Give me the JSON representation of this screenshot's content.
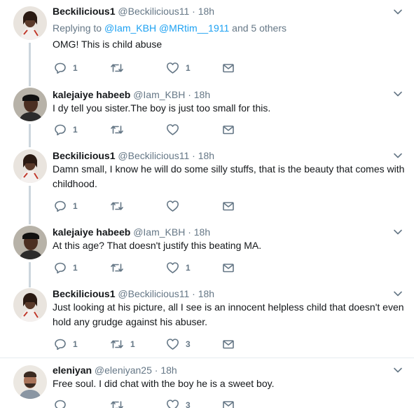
{
  "tweets": [
    {
      "name": "Beckilicious1",
      "handle": "@Beckilicious11",
      "dot": "·",
      "time": "18h",
      "replying_prefix": "Replying to",
      "replying_mention1": "@Iam_KBH",
      "replying_mention2": "@MRtim__1911",
      "replying_suffix": "and 5 others",
      "text": "OMG! This is child abuse",
      "replies": "1",
      "retweets": "",
      "likes": "1"
    },
    {
      "name": "kalejaiye habeeb",
      "handle": "@Iam_KBH",
      "dot": "·",
      "time": "18h",
      "text": "I dy tell you sister.The boy is just too small for this.",
      "replies": "1",
      "retweets": "",
      "likes": ""
    },
    {
      "name": "Beckilicious1",
      "handle": "@Beckilicious11",
      "dot": "·",
      "time": "18h",
      "text": "Damn small, I know he will do some silly stuffs, that is the beauty that comes with childhood.",
      "replies": "1",
      "retweets": "",
      "likes": ""
    },
    {
      "name": "kalejaiye habeeb",
      "handle": "@Iam_KBH",
      "dot": "·",
      "time": "18h",
      "text": "At this age? That doesn't justify this beating MA.",
      "replies": "1",
      "retweets": "",
      "likes": "1"
    },
    {
      "name": "Beckilicious1",
      "handle": "@Beckilicious11",
      "dot": "·",
      "time": "18h",
      "text": "Just looking at his picture, all I see is an innocent helpless child that doesn't even hold any grudge against his abuser.",
      "replies": "1",
      "retweets": "1",
      "likes": "3"
    },
    {
      "name": "eleniyan",
      "handle": "@eleniyan25",
      "dot": "·",
      "time": "18h",
      "text": "Free soul. I did chat with the boy he is a sweet boy.",
      "replies": "",
      "retweets": "",
      "likes": "3"
    }
  ],
  "icons": {
    "reply": "reply-icon",
    "retweet": "retweet-icon",
    "like": "heart-icon",
    "dm": "envelope-icon",
    "more": "chevron-down-icon"
  },
  "colors": {
    "name": "#14171a",
    "meta": "#657786",
    "link": "#1da1f2",
    "thread_line": "#ccd6dd",
    "divider": "#e6ecf0"
  }
}
